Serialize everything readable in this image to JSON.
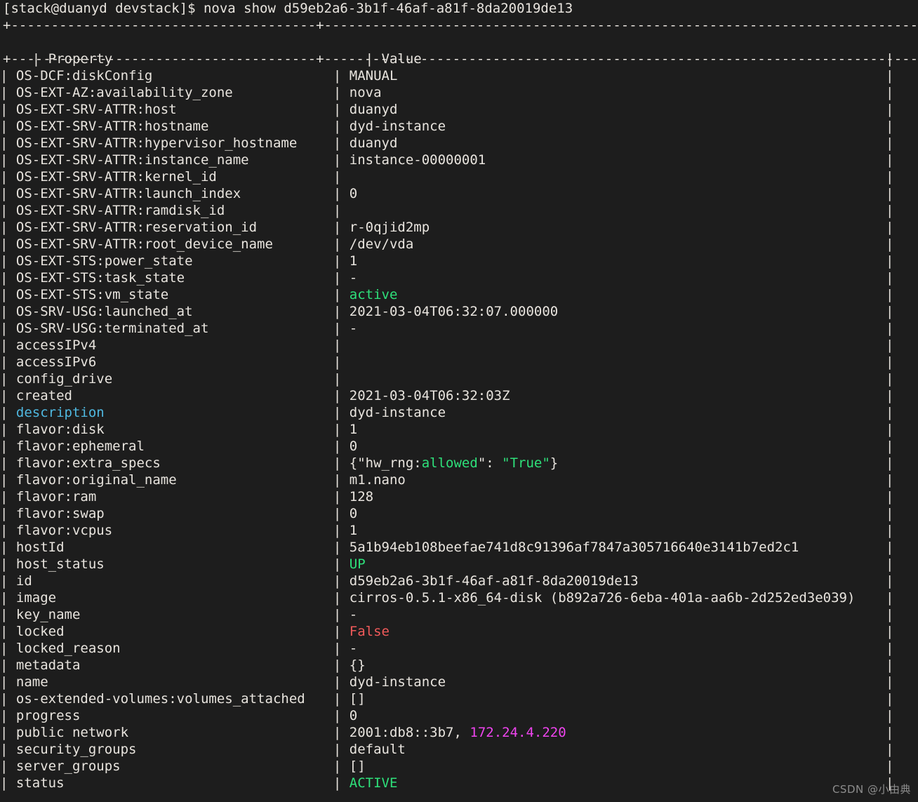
{
  "terminal": {
    "prompt": "[stack@duanyd devstack]$ ",
    "command": "nova show d59eb2a6-3b1f-46af-a81f-8da20019de13",
    "command_line": "[stack@duanyd devstack]$ nova show d59eb2a6-3b1f-46af-a81f-8da20019de13",
    "background_color": "#1d1d1d",
    "foreground_color": "#e8e4de",
    "watermark": "CSDN @小由典"
  },
  "table": {
    "border_top": "+--------------------------------------+-------------------------------------------------------------------------------+",
    "border_header": "+--------------------------------------+-------------------------------------------------------------------------------+",
    "headers": {
      "property": "Property",
      "value": "Value"
    },
    "rows": [
      {
        "property": "OS-DCF:diskConfig",
        "value": "MANUAL"
      },
      {
        "property": "OS-EXT-AZ:availability_zone",
        "value": "nova"
      },
      {
        "property": "OS-EXT-SRV-ATTR:host",
        "value": "duanyd"
      },
      {
        "property": "OS-EXT-SRV-ATTR:hostname",
        "value": "dyd-instance"
      },
      {
        "property": "OS-EXT-SRV-ATTR:hypervisor_hostname",
        "value": "duanyd"
      },
      {
        "property": "OS-EXT-SRV-ATTR:instance_name",
        "value": "instance-00000001"
      },
      {
        "property": "OS-EXT-SRV-ATTR:kernel_id",
        "value": ""
      },
      {
        "property": "OS-EXT-SRV-ATTR:launch_index",
        "value": "0"
      },
      {
        "property": "OS-EXT-SRV-ATTR:ramdisk_id",
        "value": ""
      },
      {
        "property": "OS-EXT-SRV-ATTR:reservation_id",
        "value": "r-0qjid2mp"
      },
      {
        "property": "OS-EXT-SRV-ATTR:root_device_name",
        "value": "/dev/vda"
      },
      {
        "property": "OS-EXT-STS:power_state",
        "value": "1"
      },
      {
        "property": "OS-EXT-STS:task_state",
        "value": "-"
      },
      {
        "property": "OS-EXT-STS:vm_state",
        "value": "active",
        "value_color": "green"
      },
      {
        "property": "OS-SRV-USG:launched_at",
        "value": "2021-03-04T06:32:07.000000"
      },
      {
        "property": "OS-SRV-USG:terminated_at",
        "value": "-"
      },
      {
        "property": "accessIPv4",
        "value": ""
      },
      {
        "property": "accessIPv6",
        "value": ""
      },
      {
        "property": "config_drive",
        "value": ""
      },
      {
        "property": "created",
        "value": "2021-03-04T06:32:03Z"
      },
      {
        "property": "description",
        "property_color": "cyan",
        "value": "dyd-instance"
      },
      {
        "property": "flavor:disk",
        "value": "1"
      },
      {
        "property": "flavor:ephemeral",
        "value": "0"
      },
      {
        "property": "flavor:extra_specs",
        "value": "{\"hw_rng:allowed\": \"True\"}",
        "value_segments": [
          {
            "text": "{\"hw_rng:",
            "color": "default"
          },
          {
            "text": "allowed",
            "color": "green"
          },
          {
            "text": "\": ",
            "color": "default"
          },
          {
            "text": "\"True\"",
            "color": "green"
          },
          {
            "text": "}",
            "color": "default"
          }
        ]
      },
      {
        "property": "flavor:original_name",
        "value": "m1.nano"
      },
      {
        "property": "flavor:ram",
        "value": "128"
      },
      {
        "property": "flavor:swap",
        "value": "0"
      },
      {
        "property": "flavor:vcpus",
        "value": "1"
      },
      {
        "property": "hostId",
        "value": "5a1b94eb108beefae741d8c91396af7847a305716640e3141b7ed2c1"
      },
      {
        "property": "host_status",
        "value": "UP",
        "value_color": "green"
      },
      {
        "property": "id",
        "value": "d59eb2a6-3b1f-46af-a81f-8da20019de13"
      },
      {
        "property": "image",
        "value": "cirros-0.5.1-x86_64-disk (b892a726-6eba-401a-aa6b-2d252ed3e039)"
      },
      {
        "property": "key_name",
        "value": "-"
      },
      {
        "property": "locked",
        "value": "False",
        "value_color": "red"
      },
      {
        "property": "locked_reason",
        "value": "-"
      },
      {
        "property": "metadata",
        "value": "{}"
      },
      {
        "property": "name",
        "value": "dyd-instance"
      },
      {
        "property": "os-extended-volumes:volumes_attached",
        "value": "[]"
      },
      {
        "property": "progress",
        "value": "0"
      },
      {
        "property": "public network",
        "value": "2001:db8::3b7, 172.24.4.220",
        "value_segments": [
          {
            "text": "2001:db8::3b7, ",
            "color": "default"
          },
          {
            "text": "172.24.4.220",
            "color": "magenta"
          }
        ]
      },
      {
        "property": "security_groups",
        "value": "default"
      },
      {
        "property": "server_groups",
        "value": "[]"
      },
      {
        "property": "status",
        "value": "ACTIVE",
        "value_color": "green"
      }
    ]
  },
  "colors": {
    "default": "#e8e4de",
    "green": "#2ee07a",
    "cyan": "#4fb8e0",
    "red": "#f05a5a",
    "magenta": "#ee44ee",
    "background": "#1d1d1d"
  }
}
